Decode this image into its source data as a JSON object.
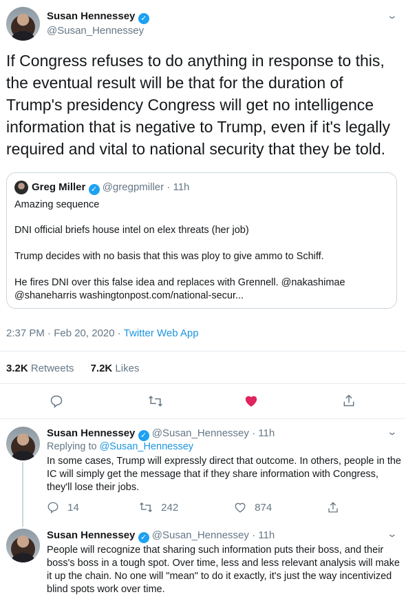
{
  "main_tweet": {
    "author_name": "Susan Hennessey",
    "author_handle": "@Susan_Hennessey",
    "text": "If Congress refuses to do anything in response to this, the eventual result will be that for the duration of Trump's presidency Congress will get no intelligence information that is negative to Trump, even if it's legally required and vital to national security that they be told.",
    "quoted": {
      "author_name": "Greg Miller",
      "author_handle": "@gregpmiller",
      "time": "11h",
      "lines": [
        "Amazing sequence",
        "DNI official briefs house intel on elex threats (her job)",
        "Trump decides with no basis that this was ploy to give ammo to Schiff.",
        "He fires DNI over this false idea and replaces with Grennell.  @nakashimae",
        "@shaneharris  washingtonpost.com/national-secur..."
      ]
    },
    "timestamp": "2:37 PM · Feb 20, 2020 · ",
    "source_app": "Twitter Web App",
    "retweets_count": "3.2K",
    "retweets_label": "Retweets",
    "likes_count": "7.2K",
    "likes_label": "Likes"
  },
  "replies": [
    {
      "author_name": "Susan Hennessey",
      "author_handle": "@Susan_Hennessey",
      "time": "11h",
      "replying_prefix": "Replying to ",
      "replying_to": "@Susan_Hennessey",
      "text": "In some cases, Trump will expressly direct that outcome. In others, people in the IC will simply get the message that if they share information with Congress, they'll lose their jobs.",
      "reply_count": "14",
      "retweet_count": "242",
      "like_count": "874"
    },
    {
      "author_name": "Susan Hennessey",
      "author_handle": "@Susan_Hennessey",
      "time": "11h",
      "text": "People will recognize that sharing such information puts their boss, and their boss's boss in a tough spot. Over time, less and less relevant analysis will make it up the chain. No one will \"mean\" to do it exactly, it's just the way incentivized blind spots work over time."
    }
  ],
  "icons": {
    "verified": "verified-badge-icon",
    "reply": "reply-icon",
    "retweet": "retweet-icon",
    "like": "heart-icon",
    "share": "share-icon",
    "more": "chevron-down-icon"
  },
  "colors": {
    "accent": "#1da1f2",
    "like_active": "#e0245e",
    "secondary_text": "#657786",
    "border": "#e6ecf0"
  }
}
